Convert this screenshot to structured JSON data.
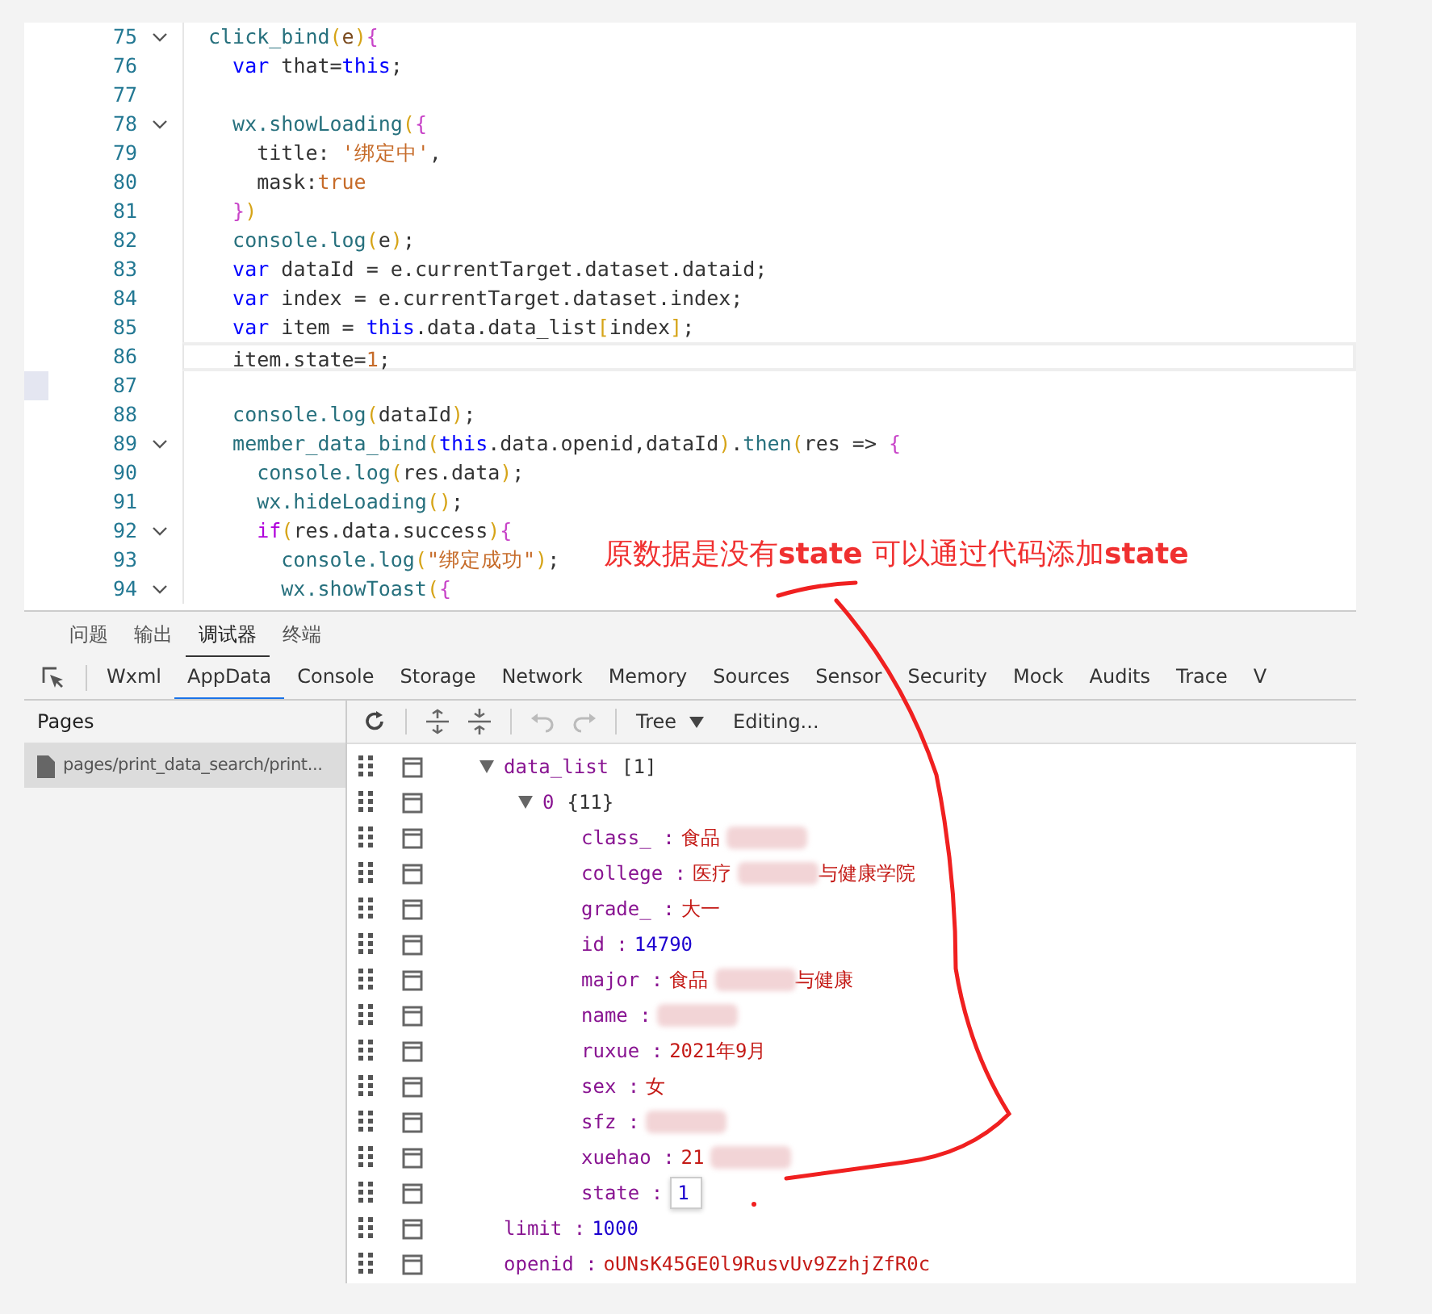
{
  "editor": {
    "lines": [
      {
        "n": "75",
        "fold": true,
        "tokens": [
          {
            "kind": "fn",
            "text": "click_bind"
          },
          {
            "kind": "br",
            "text": "("
          },
          {
            "kind": "param",
            "text": "e"
          },
          {
            "kind": "br",
            "text": ")"
          },
          {
            "kind": "br2",
            "text": "{"
          }
        ]
      },
      {
        "n": "76",
        "tokens": [
          {
            "kind": "kw",
            "text": "  var"
          },
          {
            "kind": "plain",
            "text": " that="
          },
          {
            "kind": "kw",
            "text": "this"
          },
          {
            "kind": "plain",
            "text": ";"
          }
        ]
      },
      {
        "n": "77"
      },
      {
        "n": "78",
        "fold": true,
        "tokens": [
          {
            "kind": "fn",
            "text": "  wx.showLoading"
          },
          {
            "kind": "br",
            "text": "("
          },
          {
            "kind": "br2",
            "text": "{"
          }
        ]
      },
      {
        "n": "79",
        "tokens": [
          {
            "kind": "plain",
            "text": "    title: "
          },
          {
            "kind": "str",
            "text": "'绑定中'"
          },
          {
            "kind": "plain",
            "text": ","
          }
        ]
      },
      {
        "n": "80",
        "tokens": [
          {
            "kind": "plain",
            "text": "    mask:"
          },
          {
            "kind": "lit",
            "text": "true"
          }
        ]
      },
      {
        "n": "81",
        "tokens": [
          {
            "kind": "br2",
            "text": "  }"
          },
          {
            "kind": "br",
            "text": ")"
          }
        ]
      },
      {
        "n": "82",
        "tokens": [
          {
            "kind": "fn",
            "text": "  console.log"
          },
          {
            "kind": "br",
            "text": "("
          },
          {
            "kind": "plain",
            "text": "e"
          },
          {
            "kind": "br",
            "text": ")"
          },
          {
            "kind": "plain",
            "text": ";"
          }
        ]
      },
      {
        "n": "83",
        "tokens": [
          {
            "kind": "kw",
            "text": "  var"
          },
          {
            "kind": "plain",
            "text": " dataId = e.currentTarget.dataset.dataid;"
          }
        ]
      },
      {
        "n": "84",
        "tokens": [
          {
            "kind": "kw",
            "text": "  var"
          },
          {
            "kind": "plain",
            "text": " index = e.currentTarget.dataset.index;"
          }
        ]
      },
      {
        "n": "85",
        "tokens": [
          {
            "kind": "kw",
            "text": "  var"
          },
          {
            "kind": "plain",
            "text": " item = "
          },
          {
            "kind": "kw",
            "text": "this"
          },
          {
            "kind": "plain",
            "text": ".data.data_list"
          },
          {
            "kind": "br",
            "text": "["
          },
          {
            "kind": "plain",
            "text": "index"
          },
          {
            "kind": "br",
            "text": "]"
          },
          {
            "kind": "plain",
            "text": ";"
          }
        ]
      },
      {
        "n": "86",
        "current": true,
        "tokens": [
          {
            "kind": "plain",
            "text": "  item.state="
          },
          {
            "kind": "lit",
            "text": "1"
          },
          {
            "kind": "plain",
            "text": ";"
          }
        ]
      },
      {
        "n": "87",
        "bookmarked": true
      },
      {
        "n": "88",
        "tokens": [
          {
            "kind": "fn",
            "text": "  console.log"
          },
          {
            "kind": "br",
            "text": "("
          },
          {
            "kind": "plain",
            "text": "dataId"
          },
          {
            "kind": "br",
            "text": ")"
          },
          {
            "kind": "plain",
            "text": ";"
          }
        ]
      },
      {
        "n": "89",
        "fold": true,
        "tokens": [
          {
            "kind": "fn",
            "text": "  member_data_bind"
          },
          {
            "kind": "br",
            "text": "("
          },
          {
            "kind": "kw",
            "text": "this"
          },
          {
            "kind": "plain",
            "text": ".data.openid,dataId"
          },
          {
            "kind": "br",
            "text": ")"
          },
          {
            "kind": "plain",
            "text": "."
          },
          {
            "kind": "fn",
            "text": "then"
          },
          {
            "kind": "br",
            "text": "("
          },
          {
            "kind": "plain",
            "text": "res => "
          },
          {
            "kind": "br2",
            "text": "{"
          }
        ]
      },
      {
        "n": "90",
        "tokens": [
          {
            "kind": "fn",
            "text": "    console.log"
          },
          {
            "kind": "br",
            "text": "("
          },
          {
            "kind": "plain",
            "text": "res.data"
          },
          {
            "kind": "br",
            "text": ")"
          },
          {
            "kind": "plain",
            "text": ";"
          }
        ]
      },
      {
        "n": "91",
        "tokens": [
          {
            "kind": "fn",
            "text": "    wx.hideLoading"
          },
          {
            "kind": "br",
            "text": "()"
          },
          {
            "kind": "plain",
            "text": ";"
          }
        ]
      },
      {
        "n": "92",
        "fold": true,
        "tokens": [
          {
            "kind": "ctl",
            "text": "    if"
          },
          {
            "kind": "br",
            "text": "("
          },
          {
            "kind": "plain",
            "text": "res.data.success"
          },
          {
            "kind": "br",
            "text": ")"
          },
          {
            "kind": "br2",
            "text": "{"
          }
        ]
      },
      {
        "n": "93",
        "tokens": [
          {
            "kind": "fn",
            "text": "      console.log"
          },
          {
            "kind": "br",
            "text": "("
          },
          {
            "kind": "str",
            "text": "\"绑定成功\""
          },
          {
            "kind": "br",
            "text": ")"
          },
          {
            "kind": "plain",
            "text": ";"
          }
        ]
      },
      {
        "n": "94",
        "fold": true,
        "tokens": [
          {
            "kind": "fn",
            "text": "      wx.showToast"
          },
          {
            "kind": "br",
            "text": "("
          },
          {
            "kind": "br2",
            "text": "{"
          }
        ]
      }
    ]
  },
  "annotation": {
    "text": "原数据是没有**state** 可以通过代码添加**state**"
  },
  "panel_tabs": [
    {
      "label": "问题",
      "selected": false
    },
    {
      "label": "输出",
      "selected": false
    },
    {
      "label": "调试器",
      "selected": true
    },
    {
      "label": "终端",
      "selected": false
    }
  ],
  "devtools_tabs": [
    {
      "label": "Wxml",
      "selected": false
    },
    {
      "label": "AppData",
      "selected": true
    },
    {
      "label": "Console",
      "selected": false
    },
    {
      "label": "Storage",
      "selected": false
    },
    {
      "label": "Network",
      "selected": false
    },
    {
      "label": "Memory",
      "selected": false
    },
    {
      "label": "Sources",
      "selected": false
    },
    {
      "label": "Sensor",
      "selected": false
    },
    {
      "label": "Security",
      "selected": false
    },
    {
      "label": "Mock",
      "selected": false
    },
    {
      "label": "Audits",
      "selected": false
    },
    {
      "label": "Trace",
      "selected": false
    },
    {
      "label": "V",
      "selected": false
    }
  ],
  "pages": {
    "title": "Pages",
    "items": [
      {
        "label": "pages/print_data_search/print...",
        "selected": true
      }
    ]
  },
  "toolbar": {
    "view_mode": "Tree",
    "status": "Editing..."
  },
  "tree": [
    {
      "key": "data_list",
      "summary": "[1]",
      "expanded": true,
      "children": [
        {
          "key": "0",
          "summary": "{11}",
          "expanded": true,
          "children": [
            {
              "key": "class_ :",
              "kind": "string",
              "value": "食品",
              "blurred": true
            },
            {
              "key": "college :",
              "kind": "string",
              "value": "医疗",
              "blurred": true,
              "value_after": "与健康学院"
            },
            {
              "key": "grade_ :",
              "kind": "string",
              "value": "大一"
            },
            {
              "key": "id :",
              "kind": "number",
              "value": "14790"
            },
            {
              "key": "major :",
              "kind": "string",
              "value": "食品",
              "blurred": true,
              "value_after": "与健康"
            },
            {
              "key": "name :",
              "kind": "string",
              "blurred": true
            },
            {
              "key": "ruxue :",
              "kind": "string",
              "value": "2021年9月"
            },
            {
              "key": "sex :",
              "kind": "string",
              "value": "女"
            },
            {
              "key": "sfz :",
              "kind": "string",
              "blurred": true
            },
            {
              "key": "xuehao :",
              "kind": "string",
              "value": "21",
              "blurred": true
            },
            {
              "key": "state :",
              "kind": "number",
              "value": "1",
              "editing": true
            }
          ]
        }
      ]
    },
    {
      "key": "limit :",
      "kind": "number",
      "value": "1000"
    },
    {
      "key": "openid :",
      "kind": "string",
      "value": "oUNsK45GE0l9RusvUv9ZzhjZfR0c"
    }
  ]
}
